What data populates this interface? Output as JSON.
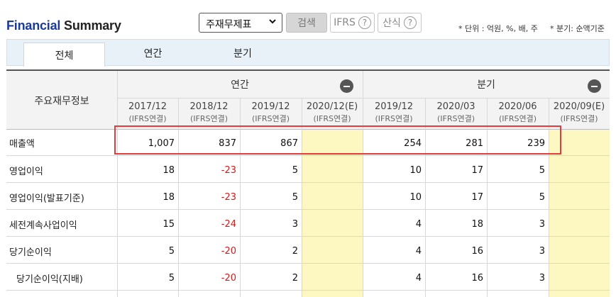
{
  "header": {
    "title_part1": "Financial",
    "title_part2": " Summary",
    "select_value": "주재무제표",
    "search_label": "검색",
    "ifrs_label": "IFRS",
    "calc_label": "산식",
    "help_glyph": "?",
    "unit_note": "* 단위 : 억원, %, 배, 주",
    "quarter_note": "* 분기: 순액기준"
  },
  "tabs": [
    "전체",
    "연간",
    "분기"
  ],
  "table": {
    "corner_label": "주요재무정보",
    "group_annual": "연간",
    "group_quarter": "분기",
    "columns": [
      {
        "period": "2017/12",
        "sub": "(IFRS연결)"
      },
      {
        "period": "2018/12",
        "sub": "(IFRS연결)"
      },
      {
        "period": "2019/12",
        "sub": "(IFRS연결)"
      },
      {
        "period": "2020/12(E)",
        "sub": "(IFRS연결)"
      },
      {
        "period": "2019/12",
        "sub": "(IFRS연결)"
      },
      {
        "period": "2020/03",
        "sub": "(IFRS연결)"
      },
      {
        "period": "2020/06",
        "sub": "(IFRS연결)"
      },
      {
        "period": "2020/09(E)",
        "sub": "(IFRS연결)"
      }
    ],
    "rows": [
      {
        "label": "매출액",
        "values": [
          "1,007",
          "837",
          "867",
          "",
          "254",
          "281",
          "239",
          ""
        ]
      },
      {
        "label": "영업이익",
        "values": [
          "18",
          "-23",
          "5",
          "",
          "10",
          "17",
          "5",
          ""
        ]
      },
      {
        "label": "영업이익(발표기준)",
        "values": [
          "18",
          "-23",
          "5",
          "",
          "10",
          "17",
          "5",
          ""
        ]
      },
      {
        "label": "세전계속사업이익",
        "values": [
          "15",
          "-24",
          "3",
          "",
          "4",
          "18",
          "3",
          ""
        ]
      },
      {
        "label": "당기순이익",
        "values": [
          "5",
          "-20",
          "2",
          "",
          "4",
          "16",
          "3",
          ""
        ]
      },
      {
        "label": "당기순이익(지배)",
        "values": [
          "5",
          "-20",
          "2",
          "",
          "4",
          "16",
          "3",
          ""
        ]
      }
    ]
  },
  "colors": {
    "brand_blue": "#1a3a9c",
    "negative_red": "#d41a1a",
    "estimate_yellow": "#fdf7c2",
    "highlight_red": "#e43c3c"
  }
}
